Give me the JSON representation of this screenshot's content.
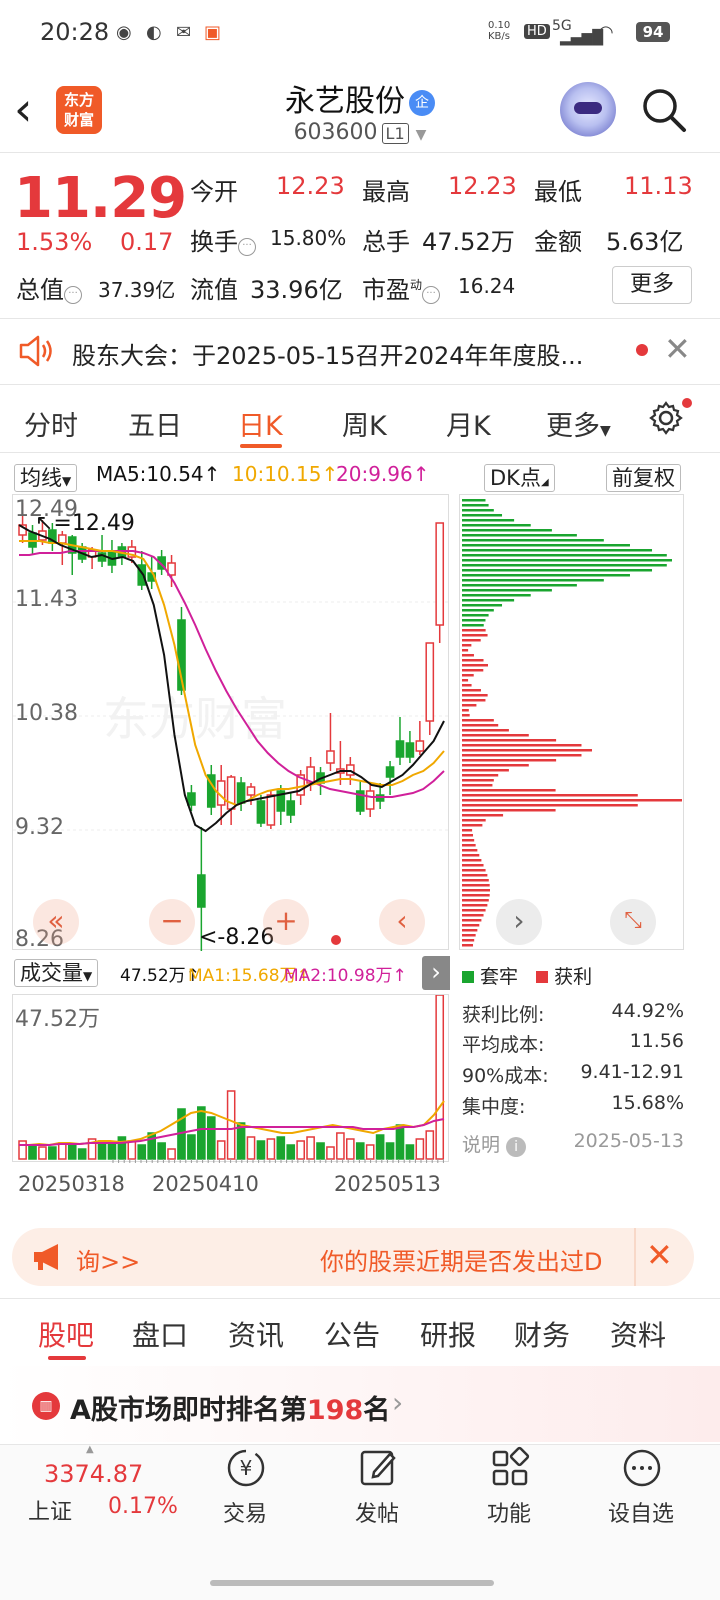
{
  "status_bar": {
    "time": "20:28",
    "net_speed": "0.10 KB/s",
    "hd": "HD",
    "signal": "5G",
    "battery": "94"
  },
  "header": {
    "stock_name": "永艺股份",
    "badge": "企",
    "stock_code": "603600",
    "level": "L1",
    "logo_text_1": "东方",
    "logo_text_2": "财富"
  },
  "quote": {
    "price": "11.29",
    "change_pct": "1.53%",
    "change_amt": "0.17",
    "open_label": "今开",
    "open_value": "12.23",
    "high_label": "最高",
    "high_value": "12.23",
    "low_label": "最低",
    "low_value": "11.13",
    "turnover_label": "换手",
    "turnover_value": "15.80%",
    "volume_label": "总手",
    "volume_value": "47.52万",
    "amount_label": "金额",
    "amount_value": "5.63亿",
    "mktcap_label": "总值",
    "mktcap_value": "37.39亿",
    "float_label": "流值",
    "float_value": "33.96亿",
    "pe_label": "市盈",
    "pe_sup": "动",
    "pe_value": "16.24",
    "more_button": "更多"
  },
  "notice": {
    "text": "股东大会：于2025-05-15召开2024年年度股..."
  },
  "chart_tabs": [
    "分时",
    "五日",
    "日K",
    "周K",
    "月K",
    "更多"
  ],
  "chart_toolbar": {
    "ma_selector": "均线",
    "ma5": "MA5:10.54",
    "ma10": "10:10.15",
    "ma20": "20:9.96",
    "dk_button": "DK点",
    "adjust_button": "前复权"
  },
  "kline_chart": {
    "y_labels": [
      "12.49",
      "11.43",
      "10.38",
      "9.32",
      "8.26"
    ],
    "high_marker": "12.49",
    "low_marker": "<-8.26",
    "watermark": "东方财富"
  },
  "volume": {
    "selector": "成交量",
    "vol_now": "47.52万",
    "ma1": "MA1:15.68万",
    "ma2": "MA2:10.98万",
    "max_label": "47.52万",
    "dates": [
      "20250318",
      "20250410",
      "20250513"
    ]
  },
  "chip_distribution": {
    "legend_trapped": "套牢",
    "legend_profit": "获利",
    "profit_ratio_label": "获利比例:",
    "profit_ratio": "44.92%",
    "avg_cost_label": "平均成本:",
    "avg_cost": "11.56",
    "cost90_label": "90%成本:",
    "cost90": "9.41-12.91",
    "concentration_label": "集中度:",
    "concentration": "15.68%",
    "explain_label": "说明",
    "date": "2025-05-13"
  },
  "banner": {
    "left_text": "询>>",
    "right_text": "你的股票近期是否发出过D"
  },
  "section_tabs": [
    "股吧",
    "盘口",
    "资讯",
    "公告",
    "研报",
    "财务",
    "资料"
  ],
  "rank": {
    "prefix": "A股市场即时排名第",
    "number": "198",
    "suffix": "名"
  },
  "bottom_nav": {
    "index_value": "3374.87",
    "index_name": "上证",
    "index_pct": "0.17%",
    "trade": "交易",
    "post": "发帖",
    "functions": "功能",
    "add_watch": "设自选"
  },
  "colors": {
    "up": "#e4393c",
    "down": "#1aa52f",
    "brand": "#f05a28",
    "ma5": "#111111",
    "ma10": "#f0a800",
    "ma20": "#d0209a"
  }
}
